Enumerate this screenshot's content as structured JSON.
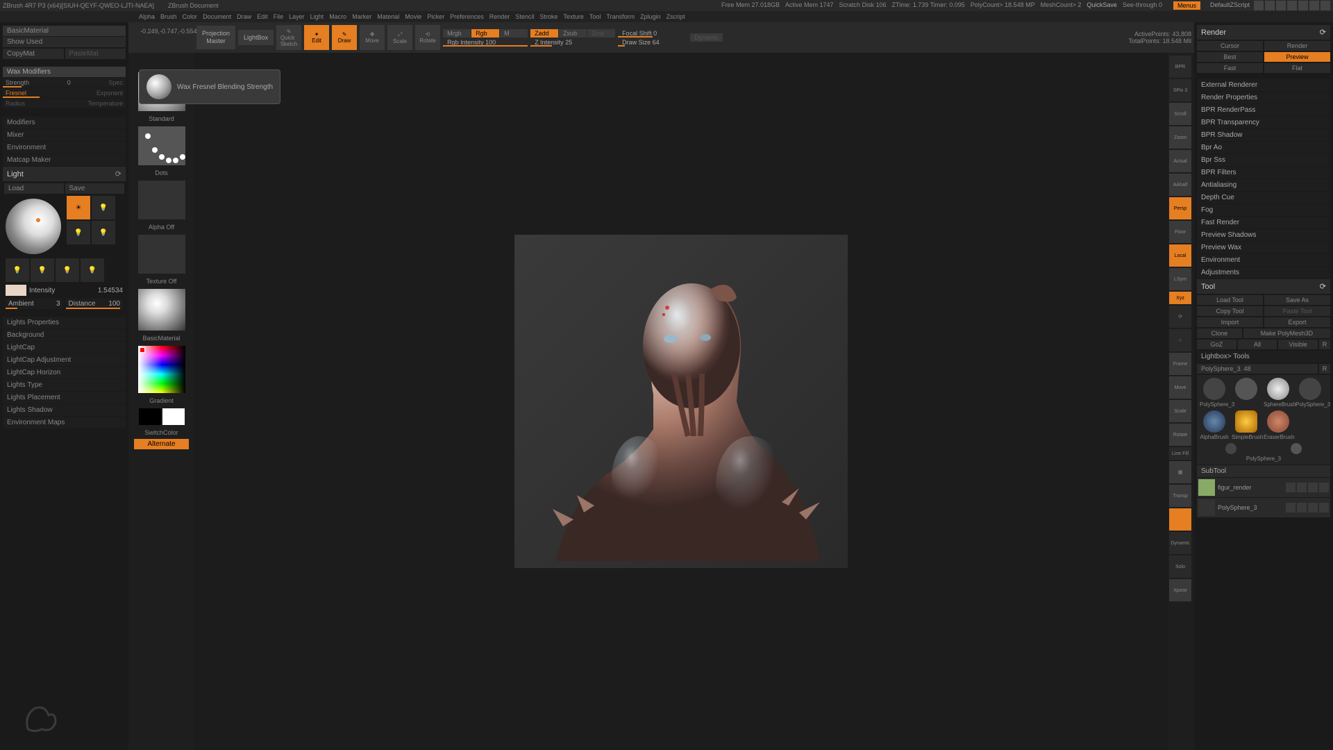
{
  "titlebar": {
    "app": "ZBrush 4R7 P3 (x64)[SIUH-QEYF-QWEO-LJTI-NAEA]",
    "doc": "ZBrush Document",
    "stats": [
      "Free Mem 27.018GB",
      "Active Mem 1747",
      "Scratch Disk 106",
      "ZTime: 1.739 Timer: 0.095",
      "PolyCount> 18.548 MP",
      "MeshCount> 2"
    ],
    "quicksave": "QuickSave",
    "seethrough": "See-through  0",
    "menus": "Menus",
    "script": "DefaultZScript"
  },
  "menubar": [
    "Alpha",
    "Brush",
    "Color",
    "Document",
    "Draw",
    "Edit",
    "File",
    "Layer",
    "Light",
    "Macro",
    "Marker",
    "Material",
    "Movie",
    "Picker",
    "Preferences",
    "Render",
    "Stencil",
    "Stroke",
    "Texture",
    "Tool",
    "Transform",
    "Zplugin",
    "Zscript"
  ],
  "leftpanel": {
    "material": "BasicMaterial",
    "showused": "Show Used",
    "copymat": "CopyMat",
    "pastemat": "PasteMat",
    "waxmod": "Wax Modifiers",
    "strength_label": "Strength",
    "strength_val": "0",
    "spec": "Spec",
    "fresnel": "Fresnel",
    "exponent": "Exponent",
    "radius": "Radius",
    "temperature": "Temperature",
    "sections": [
      "Modifiers",
      "Mixer",
      "Environment",
      "Matcap Maker"
    ],
    "light_title": "Light",
    "load": "Load",
    "save": "Save",
    "intensity_label": "Intensity",
    "intensity_val": "1.54534",
    "ambient_label": "Ambient",
    "ambient_val": "3",
    "distance_label": "Distance",
    "distance_val": "100",
    "light_sections": [
      "Lights Properties",
      "Background",
      "LightCap",
      "LightCap Adjustment",
      "LightCap Horizon",
      "Lights Type",
      "Lights Placement",
      "Lights Shadow",
      "Environment Maps"
    ]
  },
  "tooltip": "Wax Fresnel Blending Strength",
  "toolstrip": {
    "coords": "-0.249,-0.747,-0.554",
    "standard": "Standard",
    "dots": "Dots",
    "alphaoff": "Alpha Off",
    "textureoff": "Texture Off",
    "basicmat": "BasicMaterial",
    "gradient": "Gradient",
    "switchcolor": "SwitchColor",
    "alternate": "Alternate"
  },
  "shelf": {
    "projection": "Projection\nMaster",
    "lightbox": "LightBox",
    "quicksketch": "Quick\nSketch",
    "edit": "Edit",
    "draw": "Draw",
    "move": "Move",
    "scale": "Scale",
    "rotate": "Rotate",
    "mrgb": "Mrgb",
    "rgb": "Rgb",
    "m": "M",
    "rgbint": "Rgb Intensity 100",
    "zadd": "Zadd",
    "zsub": "Zsub",
    "zcut": "Zcut",
    "zint": "Z Intensity 25",
    "focalshift": "Focal Shift 0",
    "drawsize": "Draw Size 64",
    "dynamic": "Dynamic",
    "activepoints": "ActivePoints: 43,808",
    "totalpoints": "TotalPoints: 18.548 Mil"
  },
  "righticons": [
    "BPR",
    "SPix 3",
    "Scroll",
    "Zoom",
    "Actual",
    "AAhalf",
    "Persp",
    "Floor",
    "Local",
    "LSym",
    "Xyz",
    "",
    "",
    "Frame",
    "Move",
    "Scale",
    "Rotate",
    "Line Fill",
    "Grid",
    "Transp",
    "",
    "Dynamic",
    "Solo",
    "Xpose"
  ],
  "righticons_active": [
    6,
    8,
    10
  ],
  "render": {
    "title": "Render",
    "cursor": "Cursor",
    "render_btn": "Render",
    "best": "Best",
    "preview": "Preview",
    "fast": "Fast",
    "flat": "Flat",
    "items": [
      "External Renderer",
      "Render Properties",
      "BPR RenderPass",
      "BPR Transparency",
      "BPR Shadow",
      "Bpr Ao",
      "Bpr Sss",
      "BPR Filters",
      "Antialiasing",
      "Depth Cue",
      "Fog",
      "Fast Render",
      "Preview Shadows",
      "Preview Wax",
      "Environment",
      "Adjustments"
    ]
  },
  "tool": {
    "title": "Tool",
    "loadtool": "Load Tool",
    "saveas": "Save As",
    "copytool": "Copy Tool",
    "pastetool": "Paste Tool",
    "import": "Import",
    "export": "Export",
    "clone": "Clone",
    "makepoly": "Make PolyMesh3D",
    "goz": "GoZ",
    "all": "All",
    "visible": "Visible",
    "r": "R",
    "lightbox": "Lightbox> Tools",
    "polysphere": "PolySphere_3. 48",
    "thumbs": [
      "PolySphere_3",
      "SphereBrush",
      "PolySphere_3",
      "AlphaBrush",
      "SimpleBrush",
      "EraserBrush",
      "PolySphere_3"
    ],
    "subtool": "SubTool",
    "subtools": [
      "figur_render",
      "PolySphere_3"
    ]
  }
}
